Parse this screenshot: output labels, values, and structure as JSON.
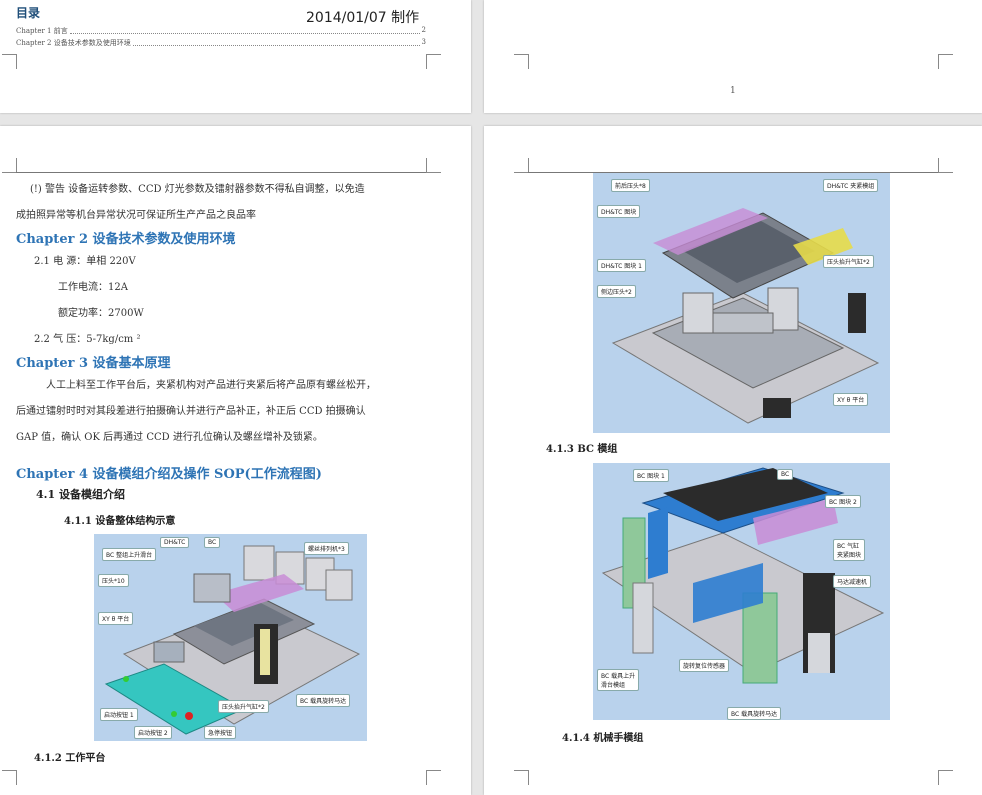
{
  "toc": {
    "title": "目录",
    "date": "2014/01/07 制作",
    "entries": [
      {
        "label": "Chapter 1 前言",
        "page": "2"
      },
      {
        "label": "Chapter 2 设备技术参数及使用环境",
        "page": "3"
      }
    ]
  },
  "page_number": "1",
  "left_page": {
    "warning_line1": "(!) 警告 设备运转参数、CCD 灯光参数及镭射器参数不得私自调整，以免造",
    "warning_line2": "成拍照异常等机台异常状况可保证所生产产品之良品率",
    "chapter2_title": "Chapter 2 设备技术参数及使用环境",
    "power_line": "2.1 电   源：单相 220V",
    "current_line": "工作电流：12A",
    "rated_power_line": "额定功率：2700W",
    "air_line": "2.2 气   压：5-7kg/cm ²",
    "chapter3_title": "Chapter 3 设备基本原理",
    "principle_line1": "人工上料至工作平台后，夹紧机构对产品进行夹紧后将产品原有螺丝松开，",
    "principle_line2": "后通过镭射时时对其段差进行拍摄确认并进行产品补正，补正后 CCD 拍摄确认",
    "principle_line3": "GAP 值，确认 OK 后再通过 CCD 进行孔位确认及螺丝增补及锁紧。",
    "chapter4_title": "Chapter 4 设备模组介绍及操作 SOP(工作流程图)",
    "section41": "4.1 设备模组介绍",
    "section411": "4.1.1 设备整体结构示意",
    "section412": "4.1.2 工作平台",
    "figure1_callouts": {
      "bc_slide": "BC 整组上升滑台",
      "dhtc": "DH&TC",
      "bc": "BC",
      "screw_feeder": "螺丝排列机*3",
      "press_head": "压头*10",
      "xy_platform": "XY θ 平台",
      "lift_cylinder": "压头抬升气缸*2",
      "bc_motor": "BC 载具旋转马达",
      "start_btn1": "启动按钮 1",
      "start_btn2": "启动按钮 2",
      "stop_btn": "急停按钮"
    }
  },
  "right_page": {
    "section413": "4.1.3  BC 模组",
    "section414": "4.1.4 机械手模组",
    "figure2_callouts": {
      "rear_press": "前后压头*8",
      "dhtc_block": "DH&TC 图块",
      "dhtc_clamp": "DH&TC 夹紧模组",
      "dhtc_block1": "DH&TC 图块 1",
      "lift_cylinder": "压头抬升气缸*2",
      "side_press": "侧边压头*2",
      "xy_platform": "XY θ 平台"
    },
    "figure3_callouts": {
      "bc_block1": "BC 图块 1",
      "bc": "BC",
      "bc_block2": "BC 图块 2",
      "bc_cylinder": "BC 气缸",
      "bc_cylinder2": "夹紧图块",
      "motor": "马达减速机",
      "bc_lift": "BC 载具上升",
      "bc_lift2": "滑台模组",
      "reset_sensor": "旋转复位传感器",
      "bc_rotate_motor": "BC 载具旋转马达"
    }
  }
}
